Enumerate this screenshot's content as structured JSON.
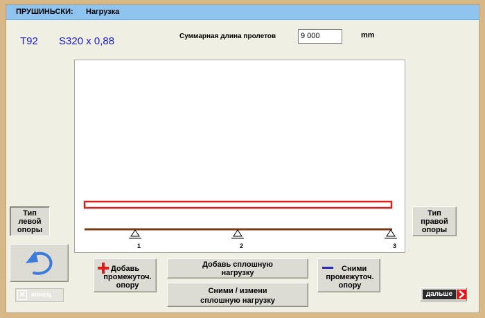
{
  "titlebar": {
    "app_name": "ПРУШИНЬСКИ:",
    "screen_name": "Нагрузка"
  },
  "header": {
    "profile_code": "T92",
    "section": "S320 x 0,88"
  },
  "span": {
    "label": "Суммарная  длина  пролетов",
    "value": "9 000",
    "unit": "mm"
  },
  "supports": {
    "labels": [
      "1",
      "2",
      "3"
    ]
  },
  "buttons": {
    "left_support_type": [
      "Тип",
      "левой",
      "опоры"
    ],
    "right_support_type": [
      "Тип",
      "правой",
      "опоры"
    ],
    "undo_icon": "undo-arrow-icon",
    "add_intermediate_support": [
      "Добавь",
      "промежуточ.",
      "опору"
    ],
    "add_distributed_load": [
      "Добавь сплошную",
      "нагрузку"
    ],
    "edit_distributed_load": [
      "Сними  /  измени",
      "сплошную нагрузку"
    ],
    "remove_intermediate_support": [
      "Сними",
      "промежуточ.",
      "опору"
    ],
    "end": "конец",
    "next": "дальше"
  },
  "colors": {
    "titlebar": "#8fc4f0",
    "header_text": "#1a1ac8",
    "load_bar": "#d42020",
    "beam": "#7a3a14",
    "add_icon": "#e01818",
    "remove_icon": "#2a2ab8",
    "next_arrow": "#e01818"
  }
}
